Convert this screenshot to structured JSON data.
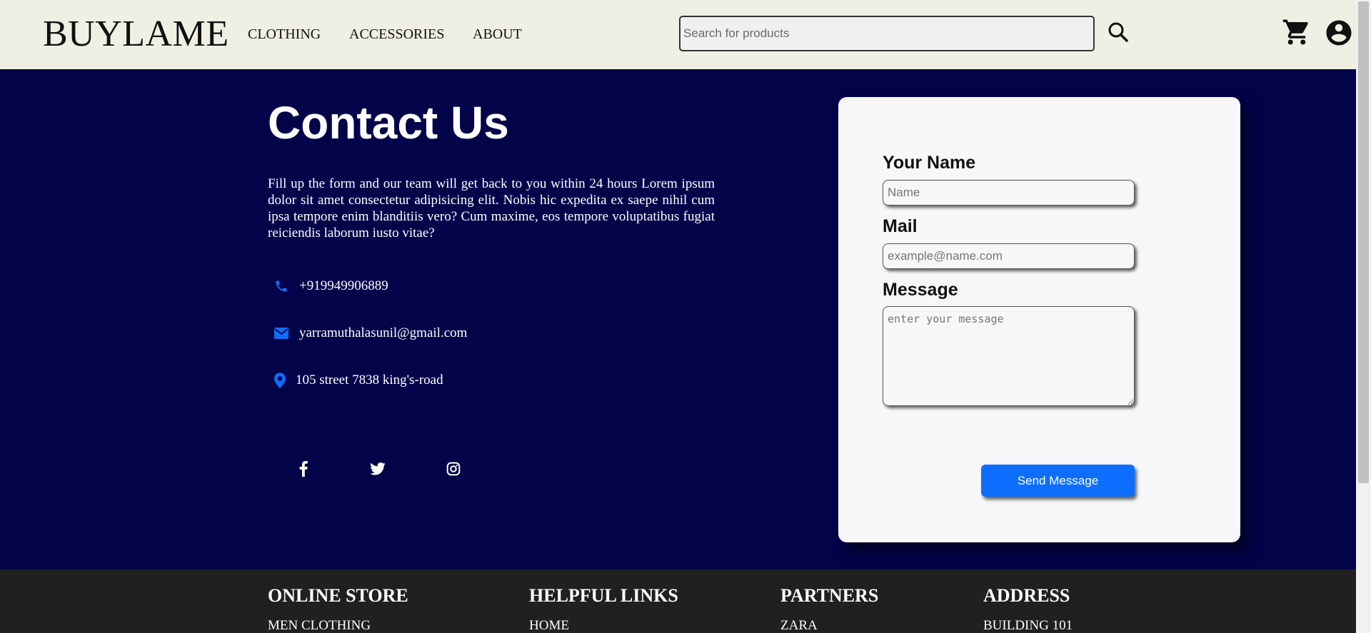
{
  "header": {
    "logo": "BUYLAME",
    "nav": [
      "CLOTHING",
      "ACCESSORIES",
      "ABOUT"
    ],
    "search_placeholder": "Search for products",
    "icons": {
      "search": "search-icon",
      "cart": "cart-icon",
      "account": "account-circle-icon"
    }
  },
  "contact": {
    "title": "Contact Us",
    "description": "Fill up the form and our team will get back to you within 24 hours Lorem ipsum dolor sit amet consectetur adipisicing elit. Nobis hic expedita ex saepe nihil cum ipsa tempore enim blanditiis vero? Cum maxime, eos tempore voluptatibus fugiat reiciendis laborum iusto vitae?",
    "phone": "+919949906889",
    "email": "yarramuthalasunil@gmail.com",
    "address": "105 street 7838 king's-road",
    "social": [
      "facebook-icon",
      "twitter-icon",
      "instagram-icon"
    ]
  },
  "form": {
    "name_label": "Your Name",
    "name_placeholder": "Name",
    "mail_label": "Mail",
    "mail_placeholder": "example@name.com",
    "message_label": "Message",
    "message_placeholder": "enter your message",
    "submit_label": "Send Message"
  },
  "footer": {
    "columns": [
      {
        "heading": "ONLINE STORE",
        "first_link": "MEN CLOTHING"
      },
      {
        "heading": "HELPFUL LINKS",
        "first_link": "HOME"
      },
      {
        "heading": "PARTNERS",
        "first_link": "ZARA"
      },
      {
        "heading": "ADDRESS",
        "first_link": "BUILDING 101"
      }
    ]
  },
  "colors": {
    "header_bg": "#f0efe3",
    "hero_bg": "#03034a",
    "accent": "#0d6efd",
    "footer_bg": "#202020",
    "card_bg": "#f7f7f9"
  }
}
